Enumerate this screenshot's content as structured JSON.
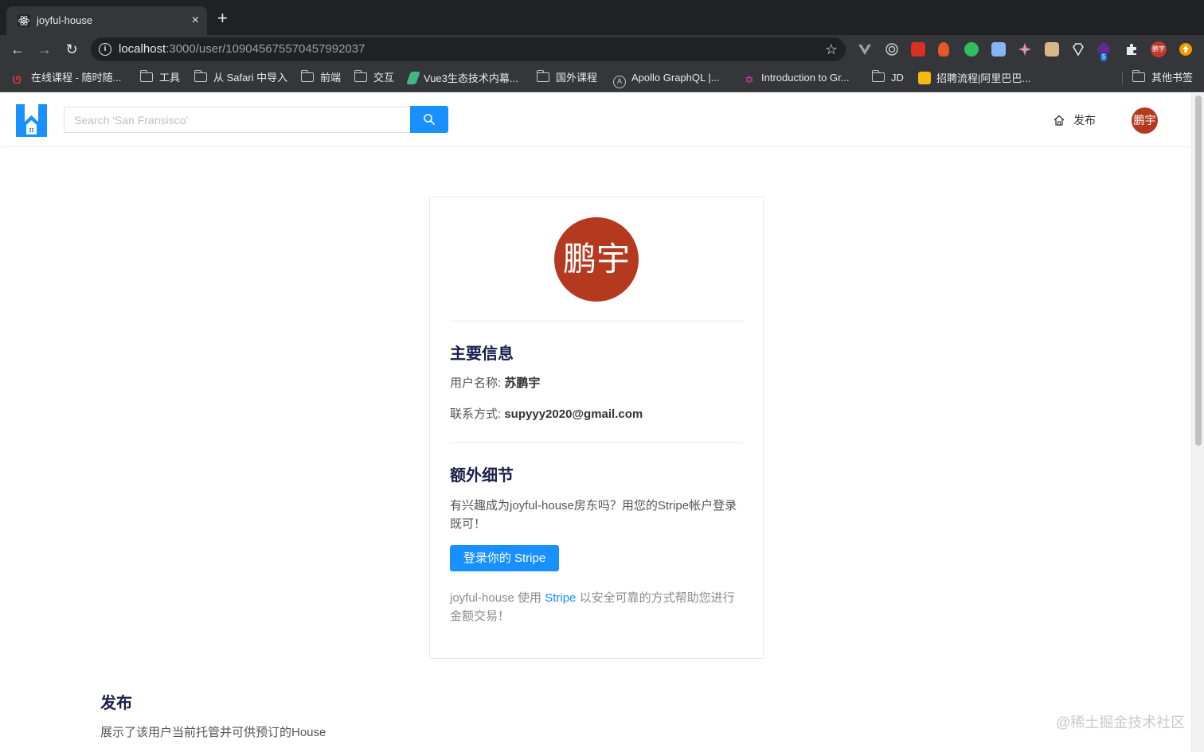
{
  "browser": {
    "tab_title": "joyful-house",
    "tab_close": "×",
    "new_tab": "+",
    "url_host": "localhost",
    "url_path": ":3000/user/109045675570457992037",
    "star": "☆",
    "profile_label": "鹏宇",
    "extension_badge": "5"
  },
  "bookmarks": [
    {
      "label": "在线课程 - 随时随...",
      "icon": "course-favicon"
    },
    {
      "label": "工具",
      "icon": "folder-icon"
    },
    {
      "label": "从 Safari 中导入",
      "icon": "folder-icon"
    },
    {
      "label": "前端",
      "icon": "folder-icon"
    },
    {
      "label": "交互",
      "icon": "folder-icon"
    },
    {
      "label": "Vue3生态技术内幕...",
      "icon": "vue-favicon"
    },
    {
      "label": "国外课程",
      "icon": "folder-icon"
    },
    {
      "label": "Apollo GraphQL |...",
      "icon": "apollo-favicon"
    },
    {
      "label": "Introduction to Gr...",
      "icon": "graphql-favicon"
    },
    {
      "label": "JD",
      "icon": "folder-icon"
    },
    {
      "label": "招聘流程|阿里巴巴...",
      "icon": "alibaba-favicon"
    },
    {
      "label": "其他书签",
      "icon": "folder-icon"
    }
  ],
  "header": {
    "search_placeholder": "Search 'San Fransisco'",
    "publish_label": "发布",
    "avatar_label": "鹏宇"
  },
  "profile": {
    "avatar_label": "鹏宇",
    "main_title": "主要信息",
    "name_label": "用户名称: ",
    "name_value": "苏鹏宇",
    "contact_label": "联系方式: ",
    "contact_value": "supyyy2020@gmail.com",
    "extra_title": "额外细节",
    "extra_text": "有兴趣成为joyful-house房东吗？用您的Stripe帐户登录既可！",
    "stripe_button": "登录你的 Stripe",
    "note_prefix": "joyful-house 使用 ",
    "note_link": "Stripe",
    "note_suffix": " 以安全可靠的方式帮助您进行金额交易！"
  },
  "listings": {
    "title": "发布",
    "description": "展示了该用户当前托管并可供预订的House"
  },
  "watermark": "@稀土掘金技术社区",
  "colors": {
    "accent": "#1890ff",
    "avatar": "#b5391e",
    "title": "#1a1f4a"
  }
}
